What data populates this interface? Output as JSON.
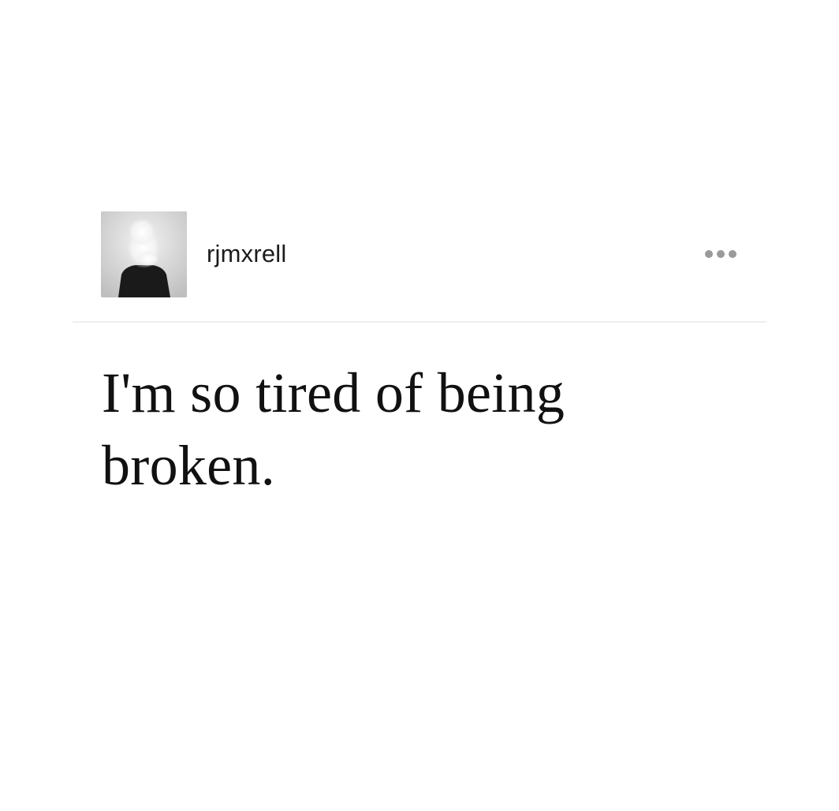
{
  "post": {
    "author": {
      "username": "rjmxrell",
      "avatar_icon": "avatar-photo"
    },
    "menu_icon": "more-horizontal-icon",
    "text": "I'm so tired of being broken."
  },
  "colors": {
    "background": "#ffffff",
    "text": "#111111",
    "username": "#1c1c1c",
    "divider": "#eeeeee",
    "menu_dots": "#9a9a9a"
  }
}
